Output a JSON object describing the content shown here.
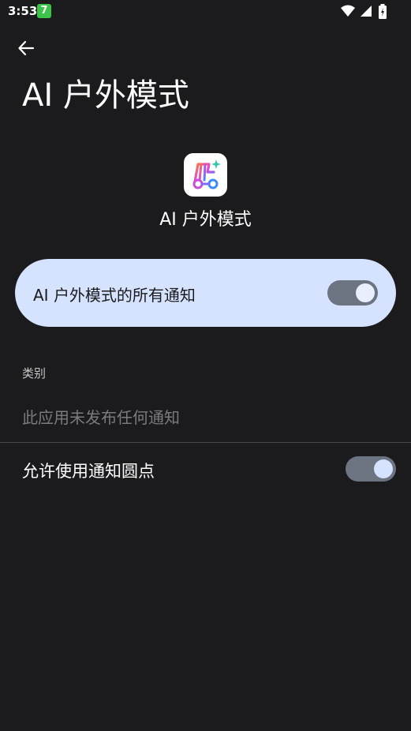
{
  "status_bar": {
    "time": "3:53",
    "app_badge": "7"
  },
  "header": {
    "title": "AI 户外模式"
  },
  "app": {
    "name": "AI 户外模式"
  },
  "main_toggle": {
    "label": "AI 户外模式的所有通知",
    "enabled": true
  },
  "categories": {
    "header": "类别",
    "empty_text": "此应用未发布任何通知"
  },
  "notification_dot": {
    "label": "允许使用通知圆点",
    "enabled": true
  },
  "colors": {
    "background": "#1b1b1d",
    "card": "#d5e3ff",
    "switch_track": "#6c7381"
  }
}
